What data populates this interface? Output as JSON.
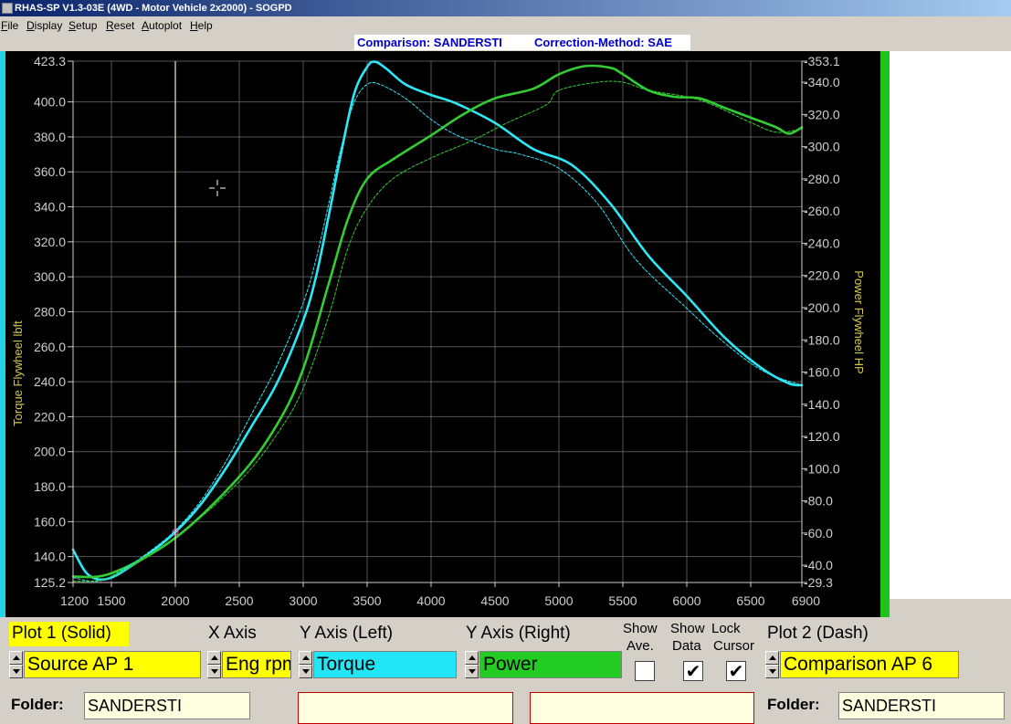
{
  "window": {
    "title": "RHAS-SP V1.3-03E  (4WD - Motor Vehicle 2x2000) - SOGPD"
  },
  "menu": [
    "File",
    "Display",
    "Setup",
    "Reset",
    "Autoplot",
    "Help"
  ],
  "info": {
    "comparison": "Comparison: SANDERSTI",
    "correction": "Correction-Method: SAE"
  },
  "colors": {
    "torque": "#2ee6f5",
    "power": "#33cc33",
    "chart_bg": "#000000",
    "grid": "#7a7a7a",
    "axis_text": "#cfcfcf",
    "axis_title": "#d4c84a"
  },
  "chart_data": {
    "type": "line",
    "xlabel": "",
    "ylabel_left": "Torque Flywheel lbft",
    "ylabel_right": "Power Flywheel HP",
    "xlim": [
      1200,
      6900
    ],
    "ylim_left": [
      125.2,
      423.3
    ],
    "ylim_right": [
      29.3,
      353.1
    ],
    "x_ticks": [
      "1200",
      "1500",
      "2000",
      "2500",
      "3000",
      "3500",
      "4000",
      "4500",
      "5000",
      "5500",
      "6000",
      "6500",
      "6900"
    ],
    "y_left_ticks": [
      "125.2",
      "140.0",
      "160.0",
      "180.0",
      "200.0",
      "220.0",
      "240.0",
      "260.0",
      "280.0",
      "300.0",
      "320.0",
      "340.0",
      "360.0",
      "380.0",
      "400.0",
      "423.3"
    ],
    "y_right_ticks": [
      "29.3",
      "40.0",
      "60.0",
      "80.0",
      "100.0",
      "120.0",
      "140.0",
      "160.0",
      "180.0",
      "200.0",
      "220.0",
      "240.0",
      "260.0",
      "280.0",
      "300.0",
      "320.0",
      "340.0",
      "353.1"
    ],
    "grid": true,
    "cursor_x": 2000,
    "series": [
      {
        "name": "Torque",
        "axis": "left",
        "style": "solid",
        "x": [
          1200,
          1300,
          1400,
          1500,
          1600,
          1800,
          2000,
          2200,
          2400,
          2600,
          2800,
          3000,
          3100,
          3200,
          3300,
          3400,
          3500,
          3560,
          3650,
          3800,
          4000,
          4200,
          4500,
          4800,
          5100,
          5400,
          5700,
          6000,
          6300,
          6600,
          6800,
          6900
        ],
        "values": [
          144,
          131,
          127,
          128,
          132,
          142,
          154,
          170,
          191,
          215,
          240,
          275,
          300,
          335,
          372,
          405,
          420,
          423,
          419,
          410,
          404,
          399,
          388,
          373,
          364,
          342,
          312,
          289,
          265,
          247,
          239,
          238
        ]
      },
      {
        "name": "Power",
        "axis": "right",
        "style": "solid",
        "x": [
          1200,
          1500,
          2000,
          2500,
          2800,
          3000,
          3200,
          3350,
          3500,
          3700,
          4000,
          4250,
          4500,
          4800,
          5000,
          5200,
          5400,
          5500,
          5700,
          5900,
          6100,
          6300,
          6500,
          6700,
          6800,
          6900
        ],
        "values": [
          33,
          35,
          57,
          95,
          128,
          162,
          215,
          255,
          280,
          292,
          307,
          320,
          330,
          336,
          345,
          350,
          349,
          345,
          335,
          331,
          330,
          324,
          318,
          312,
          308,
          312
        ]
      },
      {
        "name": "Torque",
        "axis": "left",
        "style": "dash",
        "x": [
          1200,
          1400,
          1600,
          1800,
          2000,
          2200,
          2400,
          2600,
          2800,
          3000,
          3100,
          3200,
          3300,
          3400,
          3500,
          3600,
          3800,
          4000,
          4200,
          4500,
          4700,
          5000,
          5300,
          5600,
          6000,
          6300,
          6600,
          6900
        ],
        "values": [
          128,
          126,
          133,
          143,
          155,
          172,
          195,
          222,
          250,
          285,
          310,
          342,
          375,
          400,
          410,
          410,
          402,
          390,
          381,
          373,
          370,
          362,
          342,
          310,
          282,
          262,
          246,
          238
        ]
      },
      {
        "name": "Power",
        "axis": "right",
        "style": "dash",
        "x": [
          1200,
          1500,
          2000,
          2500,
          2800,
          3000,
          3200,
          3350,
          3500,
          3700,
          4000,
          4300,
          4600,
          4900,
          5000,
          5300,
          5500,
          5700,
          6000,
          6200,
          6500,
          6700,
          6900
        ],
        "values": [
          30,
          33,
          57,
          92,
          122,
          150,
          195,
          237,
          262,
          280,
          293,
          303,
          315,
          326,
          335,
          340,
          340,
          335,
          331,
          326,
          315,
          309,
          311
        ]
      }
    ]
  },
  "controls": {
    "plot1": {
      "label": "Plot 1 (Solid)",
      "value": "Source AP 1"
    },
    "xaxis": {
      "label": "X Axis",
      "value": "Eng rpm"
    },
    "yleft": {
      "label": "Y Axis (Left)",
      "value": "Torque"
    },
    "yright": {
      "label": "Y Axis (Right)",
      "value": "Power"
    },
    "show_ave": {
      "label_line1": "Show",
      "label_line2": "Ave.",
      "checked": false,
      "mark": ""
    },
    "show_data": {
      "label_line1": "Show",
      "label_line2": "Data",
      "checked": true,
      "mark": "✔"
    },
    "lock_cursor": {
      "label_line1": "Lock",
      "label_line2": "Cursor",
      "checked": true,
      "mark": "✔"
    },
    "plot2": {
      "label": "Plot 2 (Dash)",
      "value": "Comparison AP 6"
    },
    "folder_left": {
      "label": "Folder:",
      "value": "SANDERSTI"
    },
    "folder_right": {
      "label": "Folder:",
      "value": "SANDERSTI"
    }
  }
}
